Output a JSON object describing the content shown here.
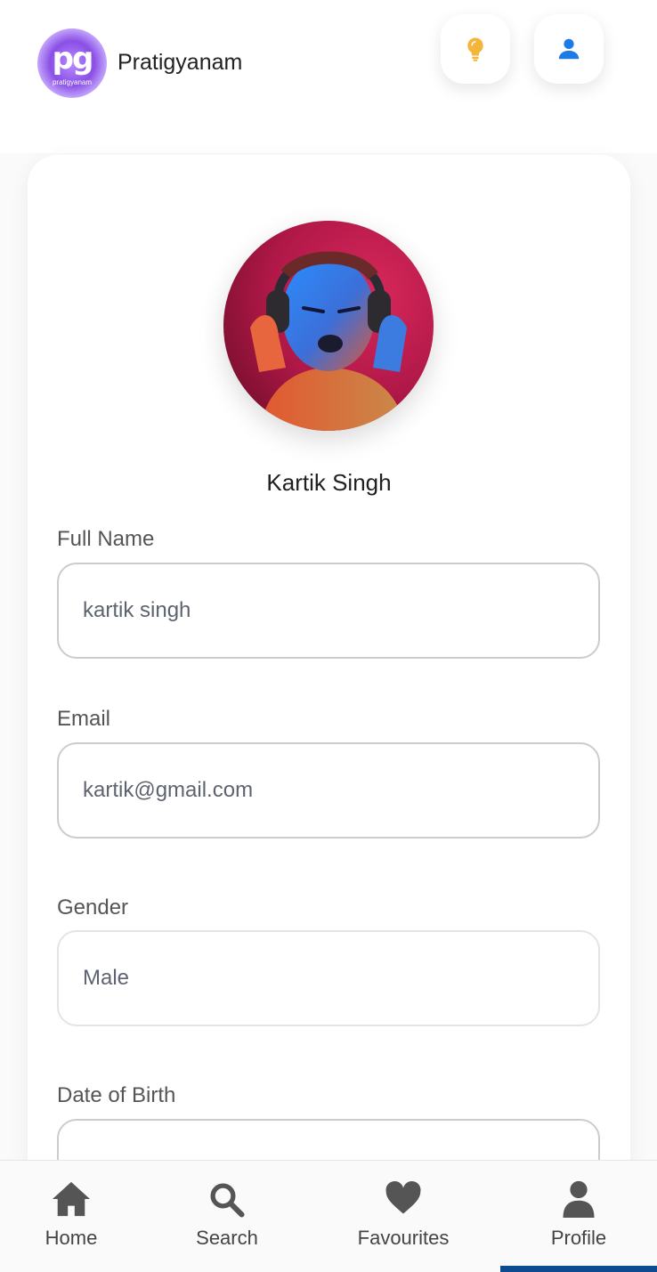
{
  "app": {
    "title": "Pratigyanam",
    "logo_text": "pg",
    "logo_subtext": "pratigyanam"
  },
  "header": {
    "tips_icon": "lightbulb-icon",
    "account_icon": "user-icon",
    "tips_icon_color": "#f4b63a",
    "account_icon_color": "#1e7be6"
  },
  "profile": {
    "display_name": "Kartik Singh"
  },
  "form": {
    "full_name": {
      "label": "Full Name",
      "value": "kartik singh"
    },
    "email": {
      "label": "Email",
      "value": "kartik@gmail.com"
    },
    "gender": {
      "label": "Gender",
      "value": "Male"
    },
    "dob": {
      "label": "Date of Birth",
      "value": ""
    }
  },
  "nav": {
    "items": [
      {
        "label": "Home",
        "icon": "home-icon"
      },
      {
        "label": "Search",
        "icon": "search-icon"
      },
      {
        "label": "Favourites",
        "icon": "heart-icon"
      },
      {
        "label": "Profile",
        "icon": "person-icon"
      }
    ],
    "active": "Profile",
    "active_color": "#0d4a8f"
  }
}
